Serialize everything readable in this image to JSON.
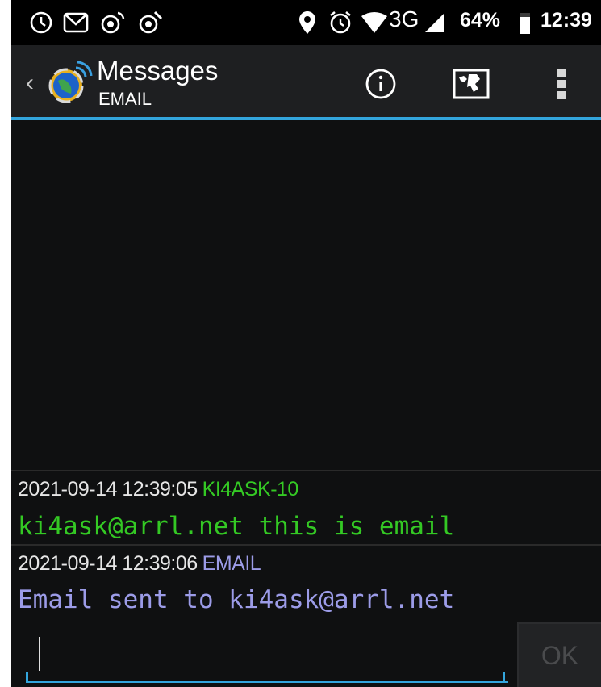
{
  "status_bar": {
    "network": "3G",
    "battery": "64%",
    "time": "12:39",
    "icons": [
      "clock-icon",
      "gmail-icon",
      "aprs-notification-icon",
      "satellite-icon",
      "location-icon",
      "alarm-icon",
      "wifi-icon",
      "signal-icon",
      "battery-icon"
    ]
  },
  "action_bar": {
    "title": "Messages",
    "subtitle": "EMAIL",
    "actions": [
      "info-icon",
      "map-icon",
      "overflow-menu-icon"
    ]
  },
  "messages": [
    {
      "timestamp": "2021-09-14 12:39:05",
      "callsign": "KI4ASK-10",
      "body": "ki4ask@arrl.net this is email",
      "meta_color": "#e6e6e6",
      "callsign_color": "#34c924",
      "body_color": "#34c924"
    },
    {
      "timestamp": "2021-09-14 12:39:06",
      "callsign": "EMAIL",
      "body": "Email sent to ki4ask@arrl.net",
      "meta_color": "#e6e6e6",
      "callsign_color": "#9c9ce8",
      "body_color": "#9c9ce8"
    }
  ],
  "compose": {
    "value": "",
    "ok_label": "OK"
  },
  "colors": {
    "accent": "#33a5dd",
    "background": "#0f1011",
    "action_bar": "#1e1f21"
  }
}
